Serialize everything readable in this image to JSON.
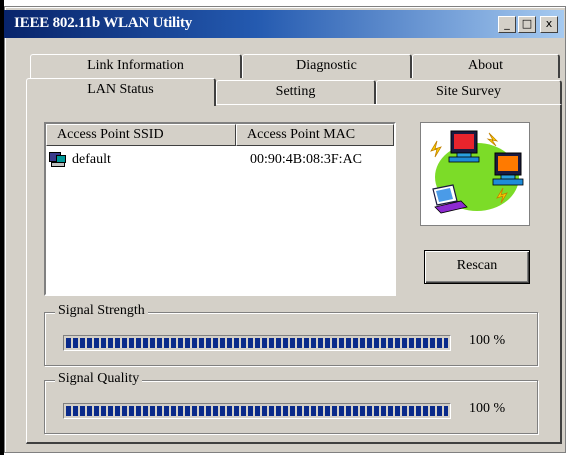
{
  "window": {
    "title": "IEEE 802.11b WLAN Utility",
    "controls": {
      "minimize": "_",
      "maximize": "□",
      "close": "x"
    }
  },
  "tabs": {
    "row_back": [
      "Link Information",
      "Diagnostic",
      "About"
    ],
    "row_front": [
      "LAN Status",
      "Setting",
      "Site Survey"
    ],
    "active": "LAN Status"
  },
  "access_point_list": {
    "columns": [
      "Access Point SSID",
      "Access Point MAC"
    ],
    "rows": [
      {
        "ssid": "default",
        "mac": "00:90:4B:08:3F:AC",
        "icon": "network-computer-icon"
      }
    ]
  },
  "picture": {
    "icon": "wireless-network-illustration-icon"
  },
  "buttons": {
    "rescan": "Rescan"
  },
  "signal_strength": {
    "label": "Signal Strength",
    "value": 100,
    "text": "100 %"
  },
  "signal_quality": {
    "label": "Signal Quality",
    "value": 100,
    "text": "100 %"
  },
  "colors": {
    "title_bar_start": "#08246b",
    "title_bar_end": "#a6caf0",
    "progress": "#0a2a8a",
    "face": "#d4d0c8"
  }
}
